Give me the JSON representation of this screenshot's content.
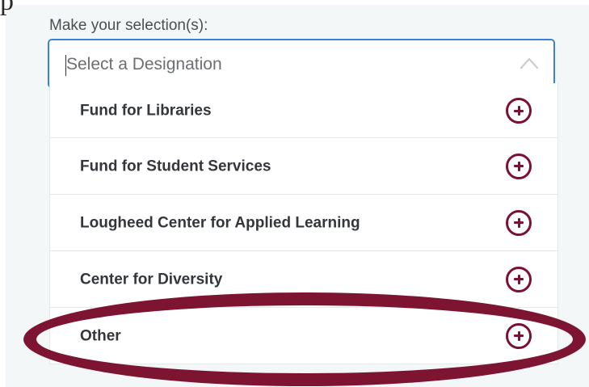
{
  "form": {
    "top_cut_text": "p",
    "prompt": "Make your selection(s):",
    "select": {
      "placeholder": "Select a Designation",
      "expanded": true
    },
    "options": [
      {
        "label": "Fund for Libraries"
      },
      {
        "label": "Fund for Student Services"
      },
      {
        "label": "Lougheed Center for Applied Learning"
      },
      {
        "label": "Center for Diversity"
      },
      {
        "label": "Other"
      }
    ]
  },
  "colors": {
    "accent": "#7b1035",
    "focus_border": "#3b82d6",
    "annotation": "#7d1432"
  },
  "icons": {
    "add": "plus-circle-icon",
    "toggle": "chevron-up-icon"
  }
}
